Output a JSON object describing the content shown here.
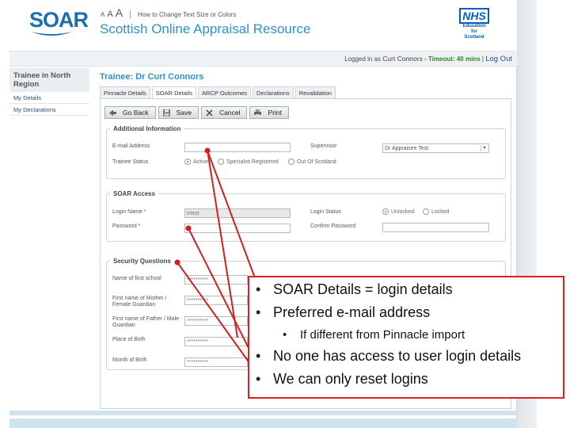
{
  "header": {
    "logo_text": "SOAR",
    "text_size_small": "A",
    "text_size_medium": "A",
    "text_size_large": "A",
    "text_size_link": "How to Change Text Size or Colors",
    "site_title": "Scottish Online Appraisal Resource",
    "nhs_logo": "NHS",
    "nhs_line1": "Education",
    "nhs_line2": "for",
    "nhs_line3": "Scotland"
  },
  "login_bar": {
    "logged_in_as": "Logged in as",
    "user": "Curt Connors",
    "timeout_label": "- Timeout:",
    "timeout_value": "40 mins",
    "separator": "|",
    "logout": "Log Out"
  },
  "sidebar": {
    "region": "Trainee in North Region",
    "items": [
      {
        "label": "My Details"
      },
      {
        "label": "My Declarations"
      }
    ]
  },
  "main": {
    "title": "Trainee: Dr Curt Connors",
    "tabs": [
      {
        "label": "Pinnacle Details"
      },
      {
        "label": "SOAR Details"
      },
      {
        "label": "ARCP Outcomes"
      },
      {
        "label": "Declarations"
      },
      {
        "label": "Revalidation"
      }
    ],
    "active_tab": "SOAR Details",
    "toolbar": {
      "go_back": "Go Back",
      "save": "Save",
      "cancel": "Cancel",
      "print": "Print"
    }
  },
  "additional_info": {
    "legend": "Additional Information",
    "email_label": "E-mail Address",
    "email_value": "",
    "supervisor_label": "Supervisor",
    "supervisor_value": "Dr Appraisee Test",
    "status_label": "Trainee Status",
    "status_options": [
      "Active",
      "Specialist Registered",
      "Out Of Scotland"
    ],
    "status_selected": "Active"
  },
  "soar_access": {
    "legend": "SOAR Access",
    "login_name_label": "Login Name *",
    "login_name_value": "trtest",
    "password_label": "Password *",
    "login_status_label": "Login Status",
    "login_status_options": [
      "Unlocked",
      "Locked"
    ],
    "login_status_selected": "Unlocked",
    "confirm_password_label": "Confirm Password"
  },
  "security": {
    "legend": "Security Questions",
    "questions": [
      {
        "label": "Name of first school",
        "value": "**********"
      },
      {
        "label": "First name of Mother / Female Guardian",
        "value": "**********"
      },
      {
        "label": "First name of Father / Male Guardian",
        "value": "**********"
      },
      {
        "label": "Place of Birth",
        "value": "**********"
      },
      {
        "label": "Month of Birth",
        "value": "**********"
      }
    ]
  },
  "callout": {
    "line1": "SOAR Details = login details",
    "line2": "Preferred e-mail address",
    "line3": "If different from Pinnacle import",
    "line4": "No one has access to user login details",
    "line5": "We can only reset logins",
    "bullet": "•",
    "border_color": "#e02020"
  },
  "colors": {
    "brand_blue": "#1a6fb0",
    "title_blue": "#2f8fcf",
    "link_blue": "#1f4e8c",
    "timeout_green": "#2a8a2a"
  }
}
